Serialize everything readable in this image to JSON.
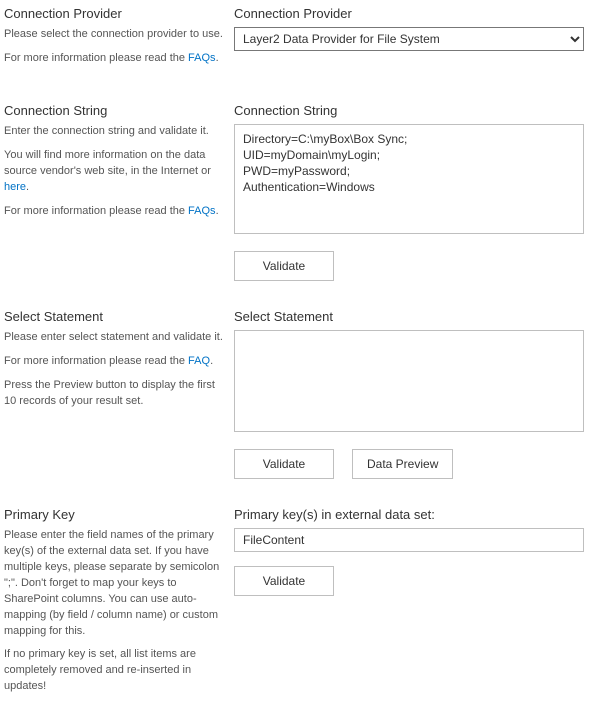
{
  "provider": {
    "left_title": "Connection Provider",
    "left_help": "Please select the connection provider to use.",
    "more_info": "For more information please read the ",
    "faq_label": "FAQs",
    "period": ".",
    "right_title": "Connection Provider",
    "selected": "Layer2 Data Provider for File System"
  },
  "connection_string": {
    "left_title": "Connection String",
    "left_help": "Enter the connection string and validate it.",
    "vendor_help_pre": "You will find more information on the data source vendor's web site, in the Internet or ",
    "vendor_help_link": "here",
    "vendor_help_post": ".",
    "more_info": "For more information please read the ",
    "faq_label": "FAQs",
    "period": ".",
    "right_title": "Connection String",
    "value": "Directory=C:\\myBox\\Box Sync;\nUID=myDomain\\myLogin;\nPWD=myPassword;\nAuthentication=Windows",
    "validate_btn": "Validate"
  },
  "select_statement": {
    "left_title": "Select Statement",
    "left_help": "Please enter select statement and validate it.",
    "more_info": "For more information please read the ",
    "faq_label": "FAQ",
    "period": ".",
    "preview_help": "Press the Preview button to display the first 10 records of your result set.",
    "right_title": "Select Statement",
    "value": "",
    "validate_btn": "Validate",
    "preview_btn": "Data Preview"
  },
  "primary_key": {
    "left_title": "Primary Key",
    "left_help": "Please enter the field names of the primary key(s) of the external data set. If you have multiple keys, please separate by semicolon \";\". Don't forget to map your keys to SharePoint columns. You can use auto-mapping (by field / column name) or custom mapping for this.",
    "left_help2": "If no primary key is set, all list items are completely removed and re-inserted in updates!",
    "right_title": "Primary key(s) in external data set:",
    "value": "FileContent",
    "validate_btn": "Validate"
  }
}
